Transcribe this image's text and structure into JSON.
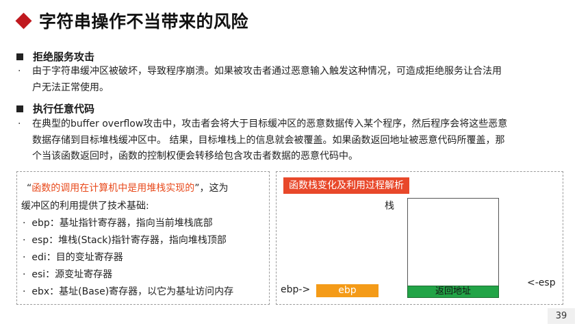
{
  "title": "字符串操作不当带来的风险",
  "sections": [
    {
      "heading": "拒绝服务攻击",
      "bullet": "·",
      "lines": [
        "由于字符串缓冲区被破坏，导致程序崩溃。如果被攻击者通过恶意输入触发这种情况，可造成拒绝服务让合法用",
        "户无法正常使用。"
      ]
    },
    {
      "heading": "执行任意代码",
      "bullet": "·",
      "lines": [
        "在典型的buffer overflow攻击中，攻击者会将大于目标缓冲区的恶意数据传入某个程序，然后程序会将这些恶意",
        "数据存储到目标堆栈缓冲区中。 结果，目标堆栈上的信息就会被覆盖。如果函数返回地址被恶意代码所覆盖，那",
        "个当该函数返回时，函数的控制权便会转移给包含攻击者数据的恶意代码中。"
      ]
    }
  ],
  "left_box": {
    "quote_open": "“",
    "quote_highlight": "函数的调用在计算机中是用堆栈实现的",
    "quote_close": "”，这为",
    "line2": "缓冲区的利用提供了技术基础:",
    "registers": [
      "ebp：基址指针寄存器，指向当前堆栈底部",
      "esp：堆栈(Stack)指针寄存器，指向堆栈顶部",
      "edi：目的变址寄存器",
      "esi：源变址寄存器",
      "ebx：基址(Base)寄存器，以它为基址访问内存"
    ]
  },
  "right_box": {
    "tag": "函数栈变化及利用过程解析",
    "stack_label": "栈",
    "return_addr": "返回地址",
    "ebp_label": "ebp->",
    "ebp_box": "ebp",
    "esp_label": "<-esp"
  },
  "page_number": "39",
  "colors": {
    "accent_red": "#c0191f",
    "tag_red": "#e8482a",
    "highlight": "#e84a1c",
    "ebp_orange": "#f49b18",
    "ret_green": "#22a447"
  }
}
